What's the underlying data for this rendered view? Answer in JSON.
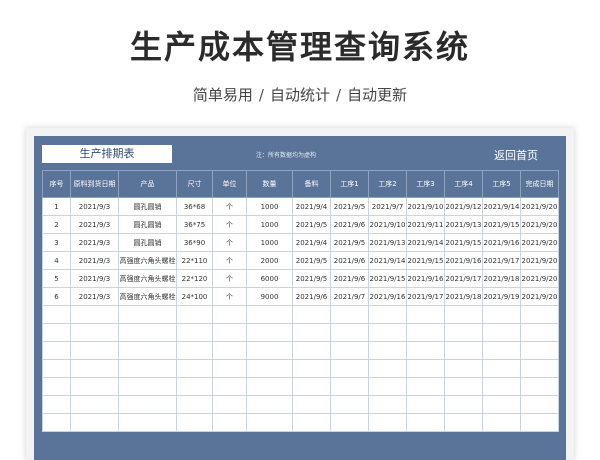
{
  "hero": {
    "title": "生产成本管理查询系统",
    "tagline": [
      "简单易用",
      "自动统计",
      "自动更新"
    ],
    "separator": "/"
  },
  "sheet": {
    "tab_title": "生产排期表",
    "note": "注：所有数据均为虚构",
    "home_button": "返回首页",
    "columns": [
      "序号",
      "原料到货日期",
      "产品",
      "尺寸",
      "单位",
      "数量",
      "备料",
      "工序1",
      "工序2",
      "工序3",
      "工序4",
      "工序5",
      "完成日期"
    ],
    "rows": [
      [
        "1",
        "2021/9/3",
        "圆孔圆销",
        "36*68",
        "个",
        "1000",
        "2021/9/4",
        "2021/9/5",
        "2021/9/7",
        "2021/9/10",
        "2021/9/12",
        "2021/9/14",
        "2021/9/20"
      ],
      [
        "2",
        "2021/9/3",
        "圆孔圆销",
        "36*75",
        "个",
        "1000",
        "2021/9/5",
        "2021/9/6",
        "2021/9/10",
        "2021/9/11",
        "2021/9/13",
        "2021/9/15",
        "2021/9/20"
      ],
      [
        "3",
        "2021/9/3",
        "圆孔圆销",
        "36*90",
        "个",
        "1000",
        "2021/9/4",
        "2021/9/5",
        "2021/9/13",
        "2021/9/14",
        "2021/9/15",
        "2021/9/16",
        "2021/9/20"
      ],
      [
        "4",
        "2021/9/3",
        "高强度六角头螺栓",
        "22*110",
        "个",
        "2000",
        "2021/9/5",
        "2021/9/6",
        "2021/9/14",
        "2021/9/15",
        "2021/9/16",
        "2021/9/17",
        "2021/9/20"
      ],
      [
        "5",
        "2021/9/3",
        "高强度六角头螺栓",
        "22*120",
        "个",
        "6000",
        "2021/9/5",
        "2021/9/6",
        "2021/9/15",
        "2021/9/16",
        "2021/9/17",
        "2021/9/18",
        "2021/9/20"
      ],
      [
        "6",
        "2021/9/3",
        "高强度六角头螺栓",
        "24*100",
        "个",
        "9000",
        "2021/9/6",
        "2021/9/7",
        "2021/9/16",
        "2021/9/17",
        "2021/9/18",
        "2021/9/19",
        "2021/9/20"
      ]
    ],
    "empty_rows": 7,
    "colors": {
      "header_bg": "#5a7399",
      "cell_bg": "#ffffff",
      "grid_line": "#c9d3e2"
    }
  }
}
